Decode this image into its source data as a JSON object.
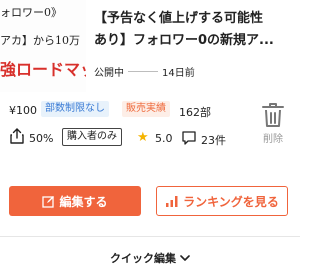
{
  "thumbnail": {
    "line1": "ォロワー0》",
    "line2": "アカ】から10万",
    "line3": "強ロードマッ"
  },
  "article": {
    "title_line1": "【予告なく値上げする可能性",
    "title_line2": "あり】フォロワー0の新規ア...",
    "status": "公開中",
    "date": "14日前"
  },
  "stats": {
    "price": "¥100",
    "badge_limit": "部数制限なし",
    "badge_sales": "販売実績",
    "sales_count": "162部",
    "share_rate": "50%",
    "buyer_only": "購入者のみ",
    "rating": "5.0",
    "reviews": "23件"
  },
  "actions": {
    "delete_label": "削除",
    "edit_label": "編集する",
    "ranking_label": "ランキングを見る",
    "quick_edit_label": "クイック編集"
  },
  "colors": {
    "accent": "#f0643c",
    "thumb_red": "#d8302b",
    "blue_badge": "#3a7bd5",
    "star": "#f5b400"
  },
  "icons": [
    "share-icon",
    "star-icon",
    "comment-icon",
    "trash-icon",
    "edit-icon",
    "ranking-icon",
    "chevron-down-icon"
  ]
}
